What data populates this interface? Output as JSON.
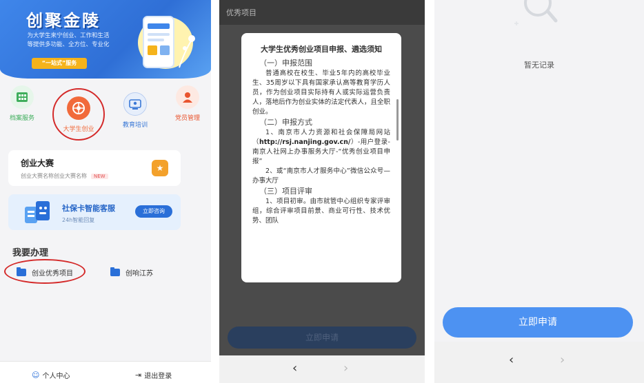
{
  "panel1": {
    "banner": {
      "title": "创聚金陵",
      "desc_line1": "为大学生来宁创业、工作和生活",
      "desc_line2": "等提供多功能、全方位、专业化",
      "button": "“一站式”服务"
    },
    "services": [
      {
        "label": "档案服务",
        "icon": "archive-icon",
        "color": "#3fae5c"
      },
      {
        "label": "大学生创业",
        "icon": "startup-icon",
        "color": "#f16a3b"
      },
      {
        "label": "教育培训",
        "icon": "education-icon",
        "color": "#3a78d6"
      },
      {
        "label": "党员管理",
        "icon": "party-member-icon",
        "color": "#e9542e"
      }
    ],
    "contest_card": {
      "title": "创业大赛",
      "subtitle": "创业大赛名称创业大赛名称",
      "badge": "NEW"
    },
    "service_card": {
      "title": "社保卡智能客服",
      "subtitle": "24h智能回复",
      "button": "立即咨询"
    },
    "todo_section": {
      "title": "我要办理",
      "items": [
        "创业优秀项目",
        "创响江苏"
      ]
    },
    "bottom_nav": {
      "personal": "个人中心",
      "logout": "退出登录"
    }
  },
  "panel2": {
    "top_title": "优秀项目",
    "modal": {
      "title": "大学生优秀创业项目申报、遴选须知",
      "section1": "（一）申报范围",
      "para1": "普通高校在校生、毕业5年内的高校毕业生、35周岁以下具有国家承认高等教育学历人员，作为创业项目实际持有人或实际运营负责人，落地后作为创业实体的法定代表人，且全职创业。",
      "section2": "（二）申报方式",
      "para2_a": "1、南京市人力资源和社会保障局网站（",
      "para2_link": "http://rsj.nanjing.gov.cn/",
      "para2_b": "）-用户登录-南京人社网上办事服务大厅-“优秀创业项目申报”",
      "para3": "2、或“南京市人才服务中心”微信公众号—办事大厅",
      "section3": "（三）项目评审",
      "para4": "1、项目初审。由市就管中心组织专家评审组，综合评审项目前景、商业可行性、技术优势、团队"
    },
    "apply_button": "立即申请",
    "nav": {
      "back": "‹",
      "forward": "›"
    }
  },
  "panel3": {
    "empty_text": "暂无记录",
    "apply_button": "立即申请",
    "nav": {
      "back": "‹",
      "forward": "›"
    }
  },
  "colors": {
    "primary_blue": "#2a6fd8",
    "banner_yellow": "#f5b31b",
    "highlight_red": "#d42a2a",
    "apply_blue": "#4d92f2"
  }
}
